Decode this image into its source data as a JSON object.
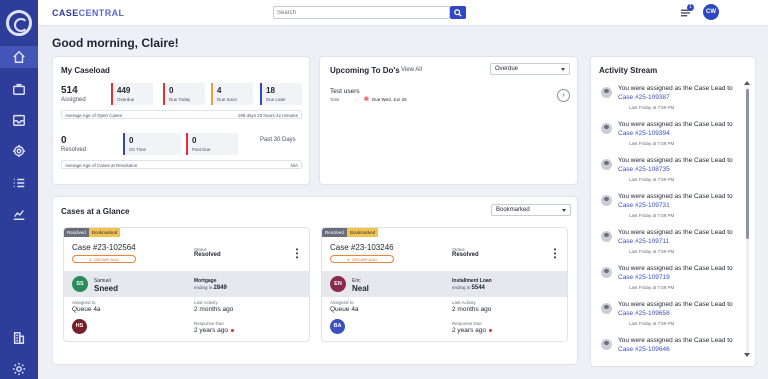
{
  "brand": {
    "part1": "CASE",
    "part2": "CENTRAL"
  },
  "search": {
    "placeholder": "Search"
  },
  "notifications": {
    "count": "1"
  },
  "user": {
    "initials": "CW"
  },
  "greeting": "Good morning, Claire!",
  "caseload": {
    "title": "My Caseload",
    "assigned": {
      "value": "514",
      "label": "Assigned"
    },
    "overdue": {
      "value": "449",
      "label": "Overdue"
    },
    "due_today": {
      "value": "0",
      "label": "Due Today"
    },
    "due_soon": {
      "value": "4",
      "label": "Due Soon"
    },
    "due_later": {
      "value": "18",
      "label": "Due Later"
    },
    "avg_age_open": {
      "label": "Average Age of Open Cases",
      "value": "198 days 23 hours 42 minutes"
    },
    "resolved": {
      "value": "0",
      "label": "Resolved"
    },
    "on_time": {
      "value": "0",
      "label": "On Time"
    },
    "past_due": {
      "value": "0",
      "label": "Past Due"
    },
    "period": "Past 30 Days",
    "avg_age_resolution": {
      "label": "Average Age of Cases at Resolution",
      "value": "N/A"
    }
  },
  "todos": {
    "title": "Upcoming To Do's",
    "view_all": "View All",
    "filter": "Overdue",
    "item": {
      "title": "Test users",
      "type": "Task",
      "sep": "-",
      "due": "Due Wed, Jun 26"
    }
  },
  "glance": {
    "title": "Cases at a Glance",
    "filter": "Bookmarked",
    "cases": [
      {
        "tag_resolved": "Resolved",
        "tag_bookmarked": "Bookmarked",
        "number": "Case #23-102564",
        "pill": "4- OSCAR* AUD",
        "status_label": "Status",
        "status": "Resolved",
        "initials": "SS",
        "first": "Samuel",
        "last": "Sneed",
        "product": "Mortgage",
        "ending_label": "ending in",
        "ending": "2849",
        "assigned_label": "Assigned to",
        "assigned": "Queue 4a",
        "activity_label": "Last Activity",
        "activity": "2 months ago",
        "lead_initials": "HS",
        "response_label": "Response Due",
        "response": "2 years ago"
      },
      {
        "tag_resolved": "Resolved",
        "tag_bookmarked": "Bookmarked",
        "number": "Case #23-103246",
        "pill": "4- OSCAR* AUD",
        "status_label": "Status",
        "status": "Resolved",
        "initials": "EN",
        "first": "Eric",
        "last": "Neal",
        "product": "Installment Loan",
        "ending_label": "ending in",
        "ending": "5544",
        "assigned_label": "Assigned to",
        "assigned": "Queue 4a",
        "activity_label": "Last Activity",
        "activity": "2 months ago",
        "lead_initials": "BA",
        "response_label": "Response Due",
        "response": "2 years ago"
      }
    ]
  },
  "activity": {
    "title": "Activity Stream",
    "items": [
      {
        "text": "You were assigned as the Case Lead to ",
        "link": "Case #25-109387",
        "time": "Last Friday at 7:59 PM"
      },
      {
        "text": "You were assigned as the Case Lead to ",
        "link": "Case #25-109394",
        "time": "Last Friday at 7:59 PM"
      },
      {
        "text": "You were assigned as the Case Lead to ",
        "link": "Case #25-108735",
        "time": "Last Friday at 7:59 PM"
      },
      {
        "text": "You were assigned as the Case Lead to ",
        "link": "Case #25-109731",
        "time": "Last Friday at 7:59 PM"
      },
      {
        "text": "You were assigned as the Case Lead to ",
        "link": "Case #25-109711",
        "time": "Last Friday at 7:59 PM"
      },
      {
        "text": "You were assigned as the Case Lead to ",
        "link": "Case #25-109719",
        "time": "Last Friday at 7:59 PM"
      },
      {
        "text": "You were assigned as the Case Lead to ",
        "link": "Case #25-109658",
        "time": "Last Friday at 7:59 PM"
      },
      {
        "text": "You were assigned as the Case Lead to ",
        "link": "Case #25-109646",
        "time": ""
      }
    ]
  },
  "colors": {
    "sidebar": "#2f3d9a",
    "accent": "#2f47c2",
    "overdue": "#d33333",
    "link": "#3750c9",
    "ss": "#2a8a5a",
    "hs": "#7a1f2a",
    "en": "#8a2a4a",
    "ba": "#3a4fc0"
  }
}
